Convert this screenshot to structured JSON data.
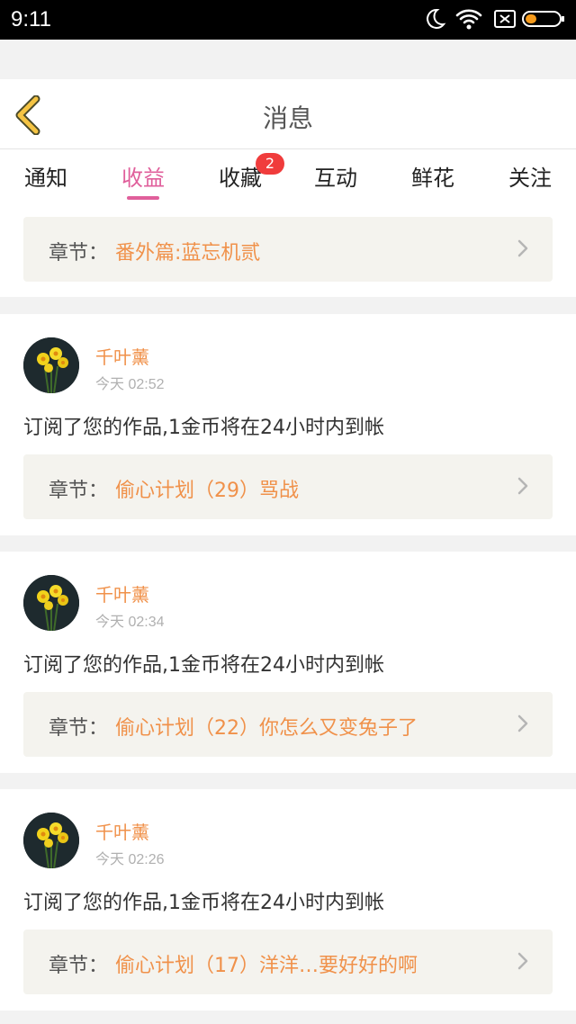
{
  "status_bar": {
    "time": "9:11",
    "icons": [
      "moon-icon",
      "wifi-icon",
      "sim-icon",
      "battery-icon"
    ]
  },
  "header": {
    "title": "消息",
    "back_icon": "chevron-left-icon"
  },
  "tabs": [
    {
      "label": "通知"
    },
    {
      "label": "收益"
    },
    {
      "label": "收藏",
      "badge": "2"
    },
    {
      "label": "互动"
    },
    {
      "label": "鲜花"
    },
    {
      "label": "关注"
    }
  ],
  "colors": {
    "accent": "#e05f9b",
    "orange": "#f0914a",
    "badge": "#f03c3c",
    "back_icon": "#f5c443"
  },
  "first_chapter": {
    "label": "章节：",
    "title": "番外篇:蓝忘机贰"
  },
  "items": [
    {
      "user": "千叶薰",
      "time": "今天 02:52",
      "message": "订阅了您的作品,1金币将在24小时内到帐",
      "chapter_label": "章节：",
      "chapter": "偷心计划（29）骂战"
    },
    {
      "user": "千叶薰",
      "time": "今天 02:34",
      "message": "订阅了您的作品,1金币将在24小时内到帐",
      "chapter_label": "章节：",
      "chapter": "偷心计划（22）你怎么又变兔子了"
    },
    {
      "user": "千叶薰",
      "time": "今天 02:26",
      "message": "订阅了您的作品,1金币将在24小时内到帐",
      "chapter_label": "章节：",
      "chapter": "偷心计划（17）洋洋…要好好的啊"
    }
  ]
}
